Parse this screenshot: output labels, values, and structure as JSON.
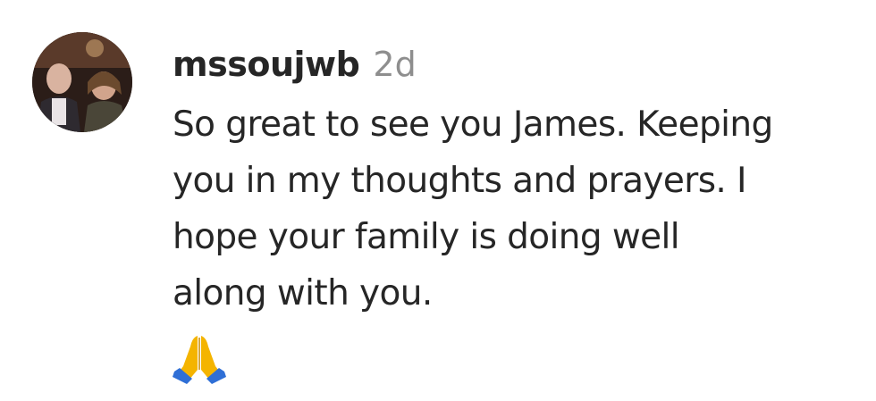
{
  "comment": {
    "username": "mssoujwb",
    "timestamp": "2d",
    "text_lines": [
      "So great to see you James. Keeping",
      "you in my thoughts and prayers. I",
      "hope your family is doing well",
      "along with you."
    ],
    "emoji": "folded-hands-icon"
  },
  "colors": {
    "text": "#262626",
    "timestamp": "#8e8e8e",
    "emoji_blue": "#2f6fd6",
    "emoji_yellow": "#f4b400"
  }
}
